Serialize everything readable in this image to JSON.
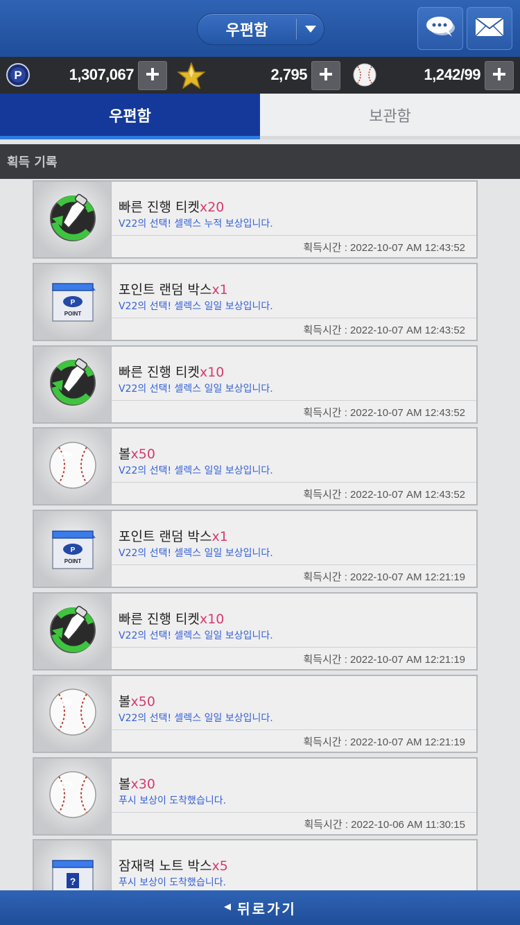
{
  "header": {
    "mailbox_select_label": "우편함"
  },
  "currency": {
    "points": "1,307,067",
    "stars": "2,795",
    "balls": "1,242/99"
  },
  "tabs": [
    {
      "label": "우편함"
    },
    {
      "label": "보관함"
    }
  ],
  "section": {
    "title": "획득 기록"
  },
  "items": [
    {
      "icon": "ticket",
      "name": "빠른 진행 티켓",
      "qty": "x20",
      "desc": "V22의 선택! 셀렉스 누적 보상입니다.",
      "time": "획득시간 : 2022-10-07 AM 12:43:52"
    },
    {
      "icon": "point-box",
      "name": "포인트 랜덤 박스",
      "qty": "x1",
      "desc": "V22의 선택! 셀렉스 일일 보상입니다.",
      "time": "획득시간 : 2022-10-07 AM 12:43:52"
    },
    {
      "icon": "ticket",
      "name": "빠른 진행 티켓",
      "qty": "x10",
      "desc": "V22의 선택! 셀렉스 일일 보상입니다.",
      "time": "획득시간 : 2022-10-07 AM 12:43:52"
    },
    {
      "icon": "ball",
      "name": "볼",
      "qty": "x50",
      "desc": "V22의 선택! 셀렉스 일일 보상입니다.",
      "time": "획득시간 : 2022-10-07 AM 12:43:52"
    },
    {
      "icon": "point-box",
      "name": "포인트 랜덤 박스",
      "qty": "x1",
      "desc": "V22의 선택! 셀렉스 일일 보상입니다.",
      "time": "획득시간 : 2022-10-07 AM 12:21:19"
    },
    {
      "icon": "ticket",
      "name": "빠른 진행 티켓",
      "qty": "x10",
      "desc": "V22의 선택! 셀렉스 일일 보상입니다.",
      "time": "획득시간 : 2022-10-07 AM 12:21:19"
    },
    {
      "icon": "ball",
      "name": "볼",
      "qty": "x50",
      "desc": "V22의 선택! 셀렉스 일일 보상입니다.",
      "time": "획득시간 : 2022-10-07 AM 12:21:19"
    },
    {
      "icon": "ball",
      "name": "볼",
      "qty": "x30",
      "desc": "푸시 보상이 도착했습니다.",
      "time": "획득시간 : 2022-10-06 AM 11:30:15"
    },
    {
      "icon": "potential-box",
      "name": "잠재력 노트 박스",
      "qty": "x5",
      "desc": "푸시 보상이 도착했습니다.",
      "time": ""
    }
  ],
  "footer": {
    "back_label": "뒤로가기"
  },
  "colors": {
    "accent": "#14399a",
    "qty": "#d63b6d",
    "desc": "#3561d6"
  }
}
